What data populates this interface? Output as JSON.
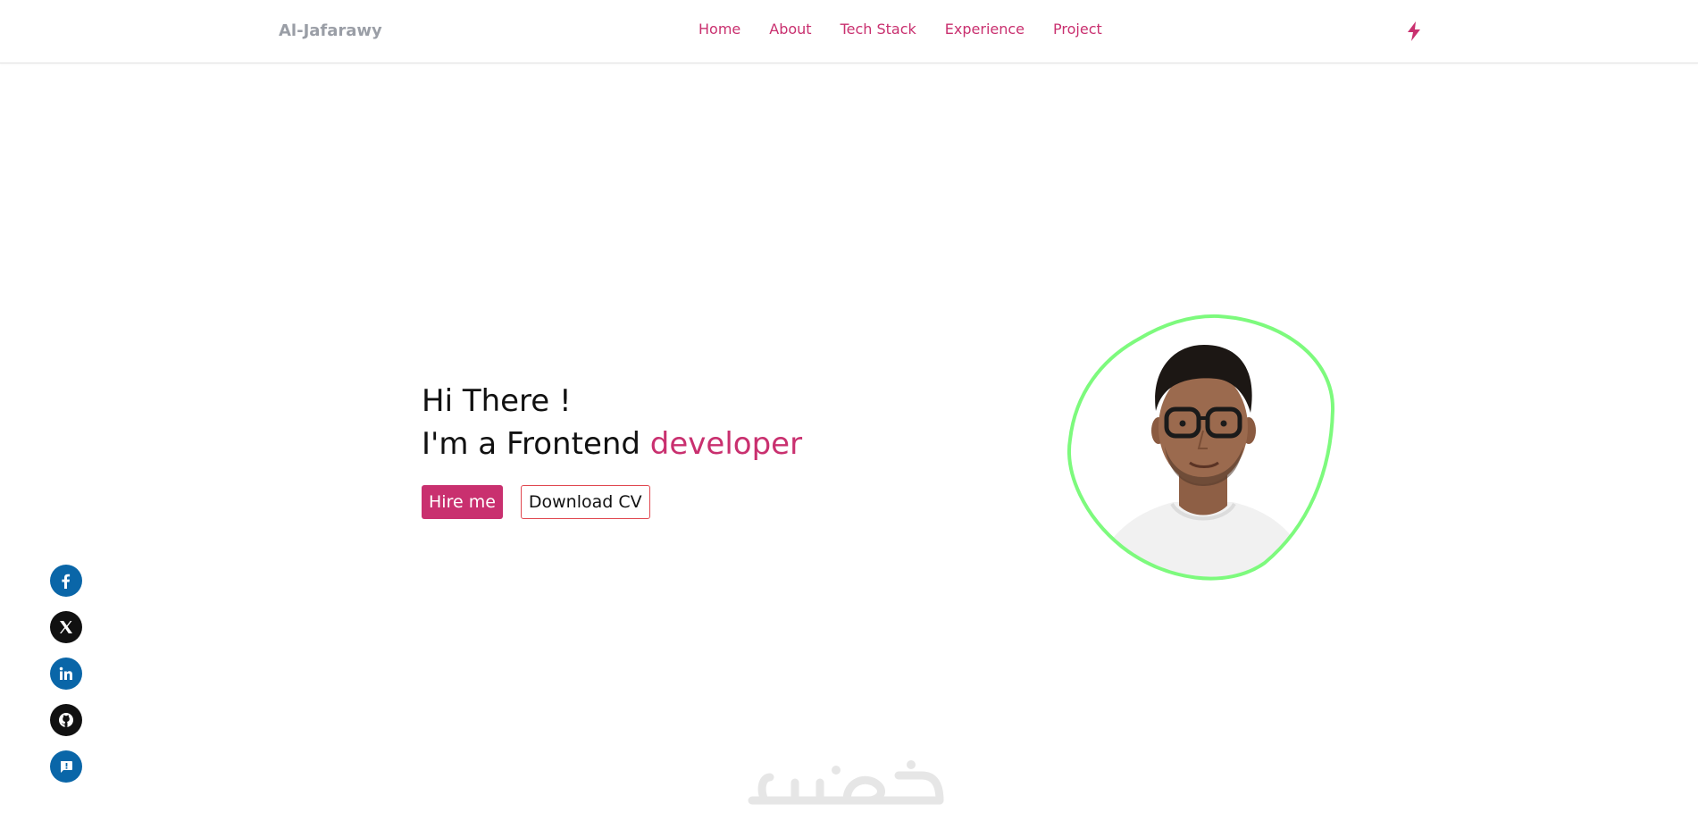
{
  "header": {
    "brand": "Al-Jafarawy",
    "nav": [
      "Home",
      "About",
      "Tech Stack",
      "Experience",
      "Project"
    ],
    "theme_toggle_icon": "lightning-bolt-icon"
  },
  "hero": {
    "greeting": "Hi There !",
    "role_prefix": "I'm a Frontend ",
    "role_accent": "developer",
    "hire_label": "Hire me",
    "cv_label": "Download CV",
    "portrait_alt": "profile-photo"
  },
  "social": [
    {
      "name": "facebook-icon",
      "color": "#0a66a8"
    },
    {
      "name": "x-twitter-icon",
      "color": "#111111"
    },
    {
      "name": "linkedin-icon",
      "color": "#0a66a8"
    },
    {
      "name": "github-icon",
      "color": "#111111"
    },
    {
      "name": "message-icon",
      "color": "#0a66a8"
    }
  ],
  "watermark": "خمسات",
  "colors": {
    "accent": "#c9306f",
    "brand_text": "#9a9ea6",
    "blob_outline": "#7dfa7d",
    "outline_border": "#e0474f"
  }
}
